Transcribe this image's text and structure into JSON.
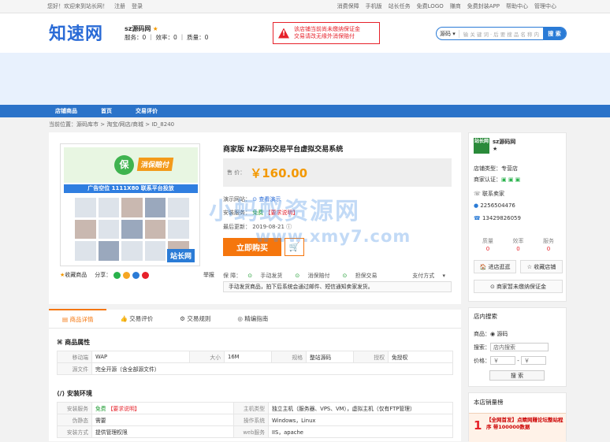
{
  "topbar": {
    "welcome": "您好！欢迎来到站长网！",
    "register": "注册",
    "login": "登录",
    "links": [
      "消费保障",
      "手机版",
      "站长任务",
      "免费LOGO",
      "赚商",
      "免费封装APP",
      "帮助中心",
      "管理中心"
    ]
  },
  "header": {
    "logo": "知速网",
    "shop_name": "sz源码网",
    "stats": "服务：0 ｜ 效率：0 ｜ 质量：0",
    "warning_line1": "该店铺当前尚未缴纳保证金",
    "warning_line2": "交易请改无缘外消保赔付",
    "search_select": "源码",
    "search_placeholder": "输 关 键 词 · 后 要 搜 品 名 称 内",
    "search_button": "搜 索"
  },
  "nav": {
    "items": [
      "店铺商品",
      "首页",
      "交易评价"
    ]
  },
  "breadcrumb": "当前位置：源码库市 > 淘宝/网店/商城 > ID_8240",
  "product": {
    "gallery_circle": "保",
    "gallery_badge": "消保赔付",
    "gallery_strip": "广告空位  1111X80  联系平台投放",
    "gallery_watermark": "站长网",
    "collect": "收藏商品",
    "share": "分享：",
    "report": "举报",
    "title": "商家版 NZ源码交易平台虚拟交易系统",
    "price_label": "售 价：",
    "price": "￥160.00",
    "demo_label": "演示网站：",
    "demo_link": "查看演示",
    "install_label": "安装服务：",
    "install_free": "免费",
    "install_ask": "【要求说明】",
    "updated_label": "最后更新：",
    "updated": "2019-08-21",
    "buy": "立即购买",
    "guarantee_label": "保  障：",
    "guarantees": [
      "手动发货",
      "消保赔付",
      "担保交易"
    ],
    "pay_method": "支付方式",
    "notice": "手动发货商品，拍下后系统会通过邮件、短信通知卖家发货。"
  },
  "tabs": [
    "商品详情",
    "交易评价",
    "交易规则",
    "精编指南"
  ],
  "attrs": {
    "title": "商品属性",
    "rows": [
      [
        "移动端",
        "WAP",
        "大小",
        "16M",
        "规格",
        "整站源码",
        "授权",
        "免授权"
      ],
      [
        "源文件",
        "完全开源（含全部源文件）"
      ]
    ]
  },
  "env": {
    "title": "安装环境",
    "rows": [
      [
        "安装服务",
        "免费",
        "【要求说明】",
        "主机类型",
        "独立主机（服务器、VPS、VM），虚拟主机（仅有FTP管理）"
      ],
      [
        "伪静态",
        "需要",
        "操作系统",
        "Windows，Linux"
      ],
      [
        "安装方式",
        "提供管理权限",
        "web服务",
        "IIS，apache"
      ]
    ]
  },
  "shop_card": {
    "logo": "站长网",
    "name": "sz源码网",
    "type": "店铺类型：专营店",
    "cert": "商家认证：",
    "contact": "联系卖家",
    "qq": "2256504476",
    "phone": "13429826059",
    "stats": [
      {
        "k": "质量",
        "v": "0"
      },
      {
        "k": "效率",
        "v": "0"
      },
      {
        "k": "服务",
        "v": "0"
      }
    ],
    "visit": "进店逛逛",
    "collect": "收藏店铺",
    "deposit": "商家暂未缴纳保证金"
  },
  "shop_search": {
    "title": "店内搜索",
    "goods_label": "商品：",
    "goods_radio": "源码",
    "search_label": "搜索：",
    "search_value": "店内搜索",
    "price_label": "价格：",
    "price_from": "￥",
    "price_to": "￥",
    "button": "搜 索"
  },
  "ranking": {
    "title": "本店销量榜",
    "rank": "1",
    "item": "【全网首发】点睛网赚论坛整站程序 带100000数据"
  },
  "watermark": {
    "cn": "小蚂蚁资源网",
    "url": "www.xmy7.com"
  }
}
